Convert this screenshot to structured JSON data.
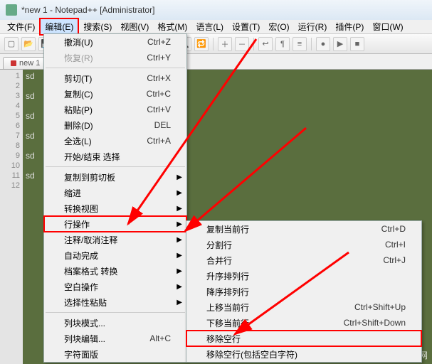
{
  "title": "*new 1 - Notepad++ [Administrator]",
  "menubar": [
    "文件(F)",
    "编辑(E)",
    "搜索(S)",
    "视图(V)",
    "格式(M)",
    "语言(L)",
    "设置(T)",
    "宏(O)",
    "运行(R)",
    "插件(P)",
    "窗口(W)"
  ],
  "menubar_hl_index": 1,
  "tab": {
    "label": "new 1"
  },
  "gutter_lines": [
    "1",
    "2",
    "3",
    "4",
    "5",
    "6",
    "7",
    "8",
    "9",
    "10",
    "11",
    "12"
  ],
  "code_lines": [
    "sd",
    "",
    "sd",
    "",
    "sd",
    "",
    "sd",
    "",
    "sd",
    "",
    "sd",
    ""
  ],
  "menu1": [
    {
      "t": "item",
      "label": "撤消(U)",
      "sc": "Ctrl+Z"
    },
    {
      "t": "item",
      "label": "恢复(R)",
      "sc": "Ctrl+Y",
      "disabled": true
    },
    {
      "t": "sep"
    },
    {
      "t": "item",
      "label": "剪切(T)",
      "sc": "Ctrl+X"
    },
    {
      "t": "item",
      "label": "复制(C)",
      "sc": "Ctrl+C"
    },
    {
      "t": "item",
      "label": "粘贴(P)",
      "sc": "Ctrl+V"
    },
    {
      "t": "item",
      "label": "删除(D)",
      "sc": "DEL"
    },
    {
      "t": "item",
      "label": "全选(L)",
      "sc": "Ctrl+A"
    },
    {
      "t": "item",
      "label": "开始/结束 选择"
    },
    {
      "t": "sep"
    },
    {
      "t": "item",
      "label": "复制到剪切板",
      "sub": true
    },
    {
      "t": "item",
      "label": "缩进",
      "sub": true
    },
    {
      "t": "item",
      "label": "转换视图",
      "sub": true
    },
    {
      "t": "item",
      "label": "行操作",
      "sub": true,
      "boxed": true
    },
    {
      "t": "item",
      "label": "注释/取消注释",
      "sub": true
    },
    {
      "t": "item",
      "label": "自动完成",
      "sub": true
    },
    {
      "t": "item",
      "label": "档案格式 转换",
      "sub": true
    },
    {
      "t": "item",
      "label": "空白操作",
      "sub": true
    },
    {
      "t": "item",
      "label": "选择性粘贴",
      "sub": true
    },
    {
      "t": "sep"
    },
    {
      "t": "item",
      "label": "列块模式..."
    },
    {
      "t": "item",
      "label": "列块编辑...",
      "sc": "Alt+C"
    },
    {
      "t": "item",
      "label": "字符面版"
    }
  ],
  "menu2": [
    {
      "t": "item",
      "label": "复制当前行",
      "sc": "Ctrl+D"
    },
    {
      "t": "item",
      "label": "分割行",
      "sc": "Ctrl+I"
    },
    {
      "t": "item",
      "label": "合并行",
      "sc": "Ctrl+J"
    },
    {
      "t": "item",
      "label": "升序排列行"
    },
    {
      "t": "item",
      "label": "降序排列行"
    },
    {
      "t": "item",
      "label": "上移当前行",
      "sc": "Ctrl+Shift+Up"
    },
    {
      "t": "item",
      "label": "下移当前行",
      "sc": "Ctrl+Shift+Down"
    },
    {
      "t": "item",
      "label": "移除空行",
      "boxed": true
    },
    {
      "t": "item",
      "label": "移除空行(包括空白字符)"
    }
  ],
  "watermark": "php 中文网"
}
